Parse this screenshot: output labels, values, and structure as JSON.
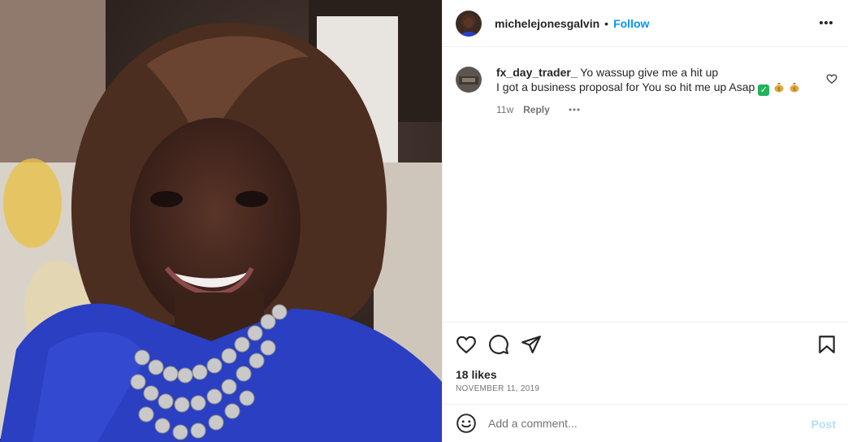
{
  "post": {
    "username": "michelejonesgalvin",
    "separator": "•",
    "follow_label": "Follow",
    "likes": "18 likes",
    "date": "NOVEMBER 11, 2019"
  },
  "comment": {
    "username": "fx_day_trader_",
    "text_line1": "Yo wassup give me a hit up",
    "text_line2": "I got a business proposal for You so hit me up Asap",
    "age": "11w",
    "reply_label": "Reply"
  },
  "composer": {
    "placeholder": "Add a comment...",
    "post_label": "Post"
  },
  "icons": {
    "header_more": "more-horizontal-icon",
    "comment_like": "heart-outline-icon",
    "like": "heart-icon",
    "comment": "comment-bubble-icon",
    "share": "paper-plane-icon",
    "save": "bookmark-icon",
    "emoji": "smiley-icon"
  },
  "colors": {
    "accent": "#0095f6",
    "post_disabled": "#b2dffc",
    "text_primary": "#262626",
    "text_secondary": "#737373"
  }
}
